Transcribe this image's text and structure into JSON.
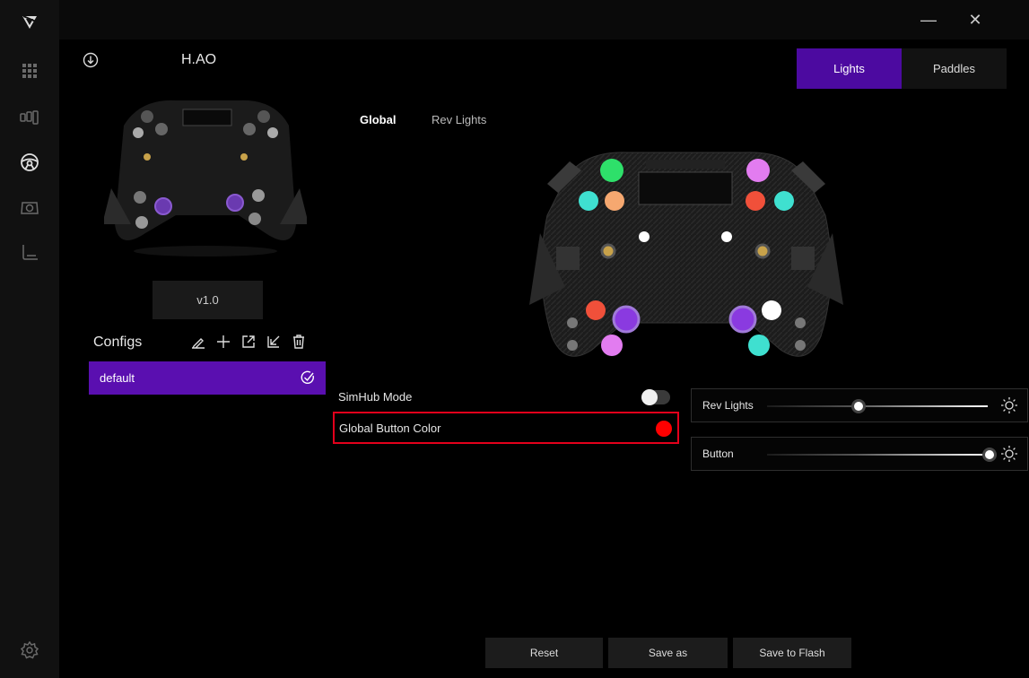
{
  "window": {
    "minimize_glyph": "—",
    "close_glyph": "✕"
  },
  "sidebar": {
    "items": [
      {
        "name": "logo-icon"
      },
      {
        "name": "apps-grid-icon"
      },
      {
        "name": "pedals-icon"
      },
      {
        "name": "steering-wheel-icon"
      },
      {
        "name": "wheelbase-icon"
      },
      {
        "name": "shifter-icon"
      },
      {
        "name": "settings-gear-icon"
      }
    ]
  },
  "profile": {
    "name": "H.AO",
    "version": "v1.0"
  },
  "configs": {
    "title": "Configs",
    "items": [
      {
        "label": "default",
        "selected": true
      }
    ]
  },
  "top_tabs": [
    {
      "label": "Lights",
      "active": true
    },
    {
      "label": "Paddles",
      "active": false
    }
  ],
  "sub_tabs": [
    {
      "label": "Global",
      "active": true
    },
    {
      "label": "Rev Lights",
      "active": false
    }
  ],
  "settings": {
    "simhub_label": "SimHub Mode",
    "simhub_on": false,
    "global_color_label": "Global Button Color",
    "global_color": "#ff0000"
  },
  "brightness": {
    "rev_label": "Rev Lights",
    "rev_value": 0.41,
    "button_label": "Button",
    "button_value": 1.0
  },
  "actions": {
    "reset": "Reset",
    "save_as": "Save as",
    "save_flash": "Save to Flash"
  },
  "colors": {
    "accent": "#5a0fb0",
    "tab_active": "#4c0aa0",
    "highlight_border": "#e3001b"
  }
}
